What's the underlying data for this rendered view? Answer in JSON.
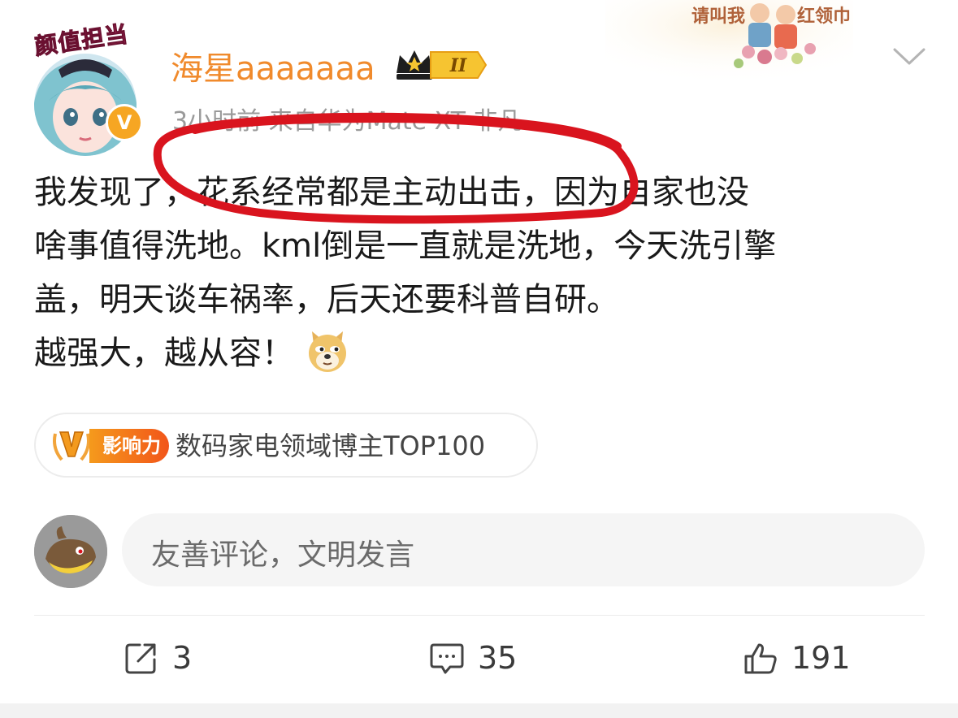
{
  "header": {
    "deco_left": "请叫我",
    "deco_right": "红领巾",
    "avatar_badge": "颜值担当",
    "verified_mark": "V",
    "username": "海星aaaaaaa",
    "level": "II",
    "meta": "3小时前  来自华为Mate XT 非凡"
  },
  "post": {
    "lines": [
      "我发现了，花系经常都是主动出击，因为自家也没",
      "啥事值得洗地。kml倒是一直就是洗地，今天洗引擎",
      "盖，明天谈车祸率，后天还要科普自研。",
      "越强大，越从容！"
    ]
  },
  "tag": {
    "chip_label": "影响力",
    "text": "数码家电领域博主TOP100"
  },
  "comment": {
    "placeholder": "友善评论，文明发言"
  },
  "actions": {
    "share_count": "3",
    "comment_count": "35",
    "like_count": "191"
  },
  "colors": {
    "username": "#f08a2c",
    "annotation": "#d9141e",
    "meta": "#9a9a9a"
  }
}
